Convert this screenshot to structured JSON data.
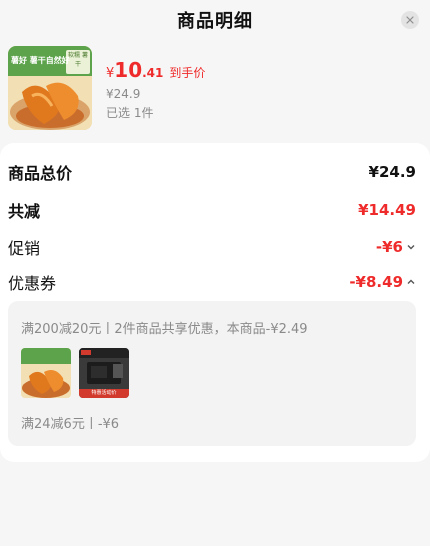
{
  "header": {
    "title": "商品明细",
    "close_icon": "close-icon"
  },
  "product": {
    "thumb_text_left": "薯好 薯干自然好",
    "thumb_badge": "软糯 薯干",
    "price_symbol": "¥",
    "price_int": "10",
    "price_dec": ".41",
    "price_tag": "到手价",
    "original_price": "¥24.9",
    "selected": "已选 1件"
  },
  "summary": {
    "total_label": "商品总价",
    "total_value": "¥24.9",
    "discount_label": "共减",
    "discount_value": "¥14.49",
    "promo_label": "促销",
    "promo_value": "-¥6",
    "coupon_label": "优惠券",
    "coupon_value": "-¥8.49"
  },
  "coupon_detail": {
    "line1": "满200减20元丨2件商品共享优惠，本商品-¥2.49",
    "item2_caption": "特惠活动价",
    "line2": "满24减6元丨-¥6"
  },
  "colors": {
    "accent_red": "#ef2a2a",
    "muted": "#8a8a8a"
  }
}
